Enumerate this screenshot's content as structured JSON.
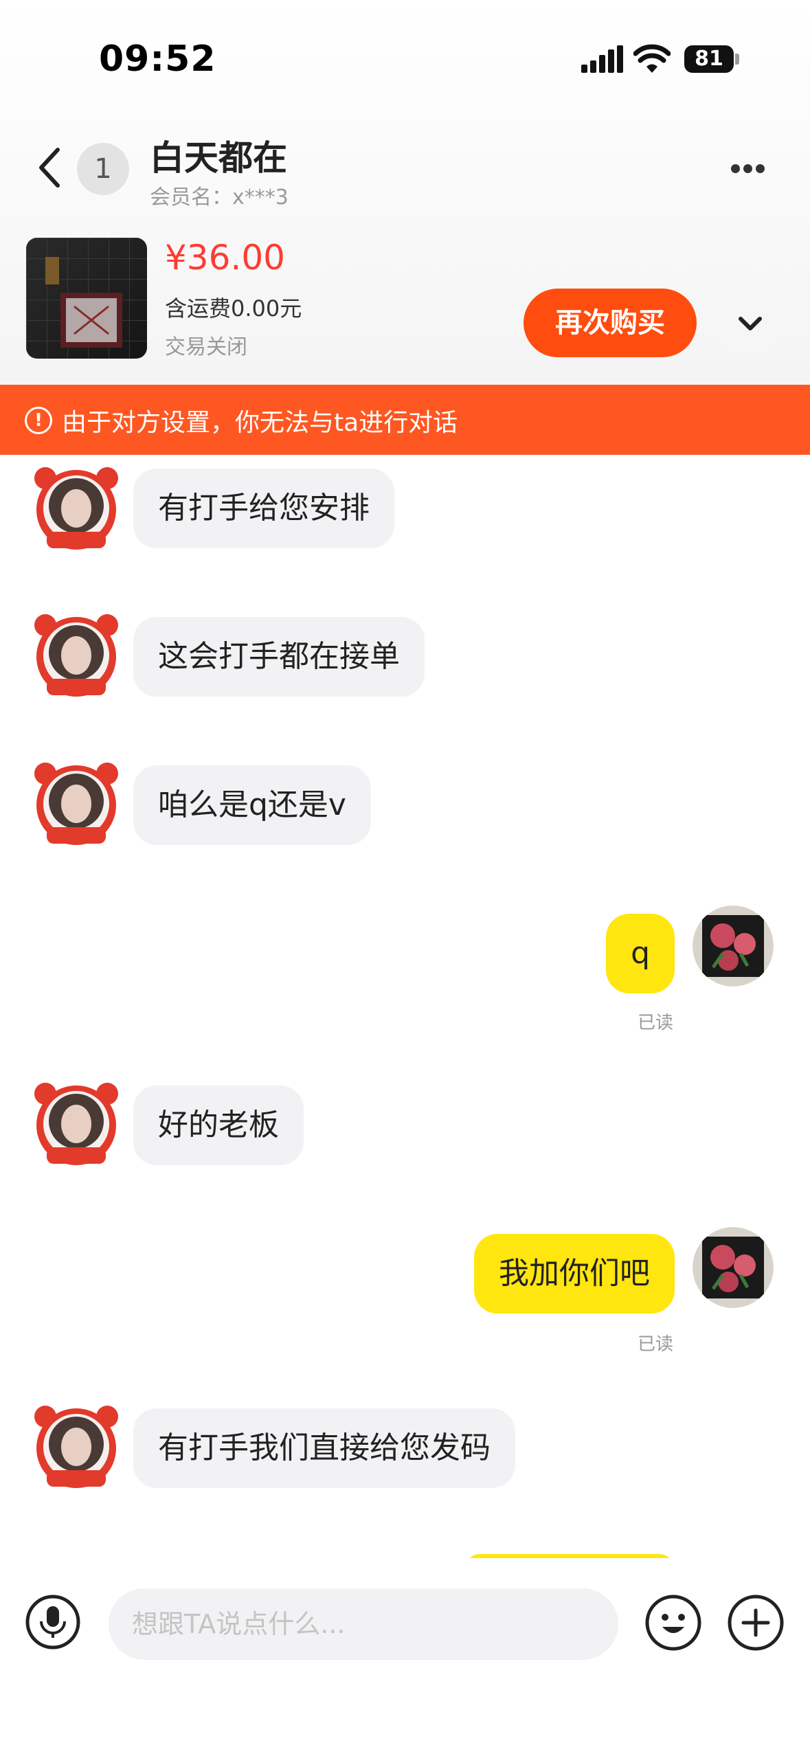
{
  "status_bar": {
    "time": "09:52",
    "battery": "81"
  },
  "header": {
    "unread_count": "1",
    "title": "白天都在",
    "member_name": "会员名：x***3"
  },
  "product": {
    "price": "¥36.00",
    "shipping": "含运费0.00元",
    "status": "交易关闭",
    "rebuy_label": "再次购买"
  },
  "banner": {
    "text": "由于对方设置，你无法与ta进行对话"
  },
  "messages": [
    {
      "side": "in",
      "text": "有打手给您安排"
    },
    {
      "side": "in",
      "text": "这会打手都在接单"
    },
    {
      "side": "in",
      "text": "咱么是q还是v"
    },
    {
      "side": "out",
      "text": "q",
      "read": "已读"
    },
    {
      "side": "in",
      "text": "好的老板"
    },
    {
      "side": "out",
      "text": "我加你们吧",
      "read": "已读"
    },
    {
      "side": "in",
      "text": "有打手我们直接给您发码"
    }
  ],
  "input": {
    "placeholder": "想跟TA说点什么..."
  },
  "colors": {
    "accent": "#ff4d0f",
    "banner": "#ff5722",
    "price": "#ff3b30",
    "outgoing_bubble": "#ffe60f",
    "incoming_bubble": "#f2f2f4"
  },
  "icons": [
    "back-arrow-icon",
    "more-dots-icon",
    "chevron-down-icon",
    "warning-icon",
    "microphone-icon",
    "emoji-icon",
    "plus-icon",
    "signal-icon",
    "wifi-icon"
  ]
}
